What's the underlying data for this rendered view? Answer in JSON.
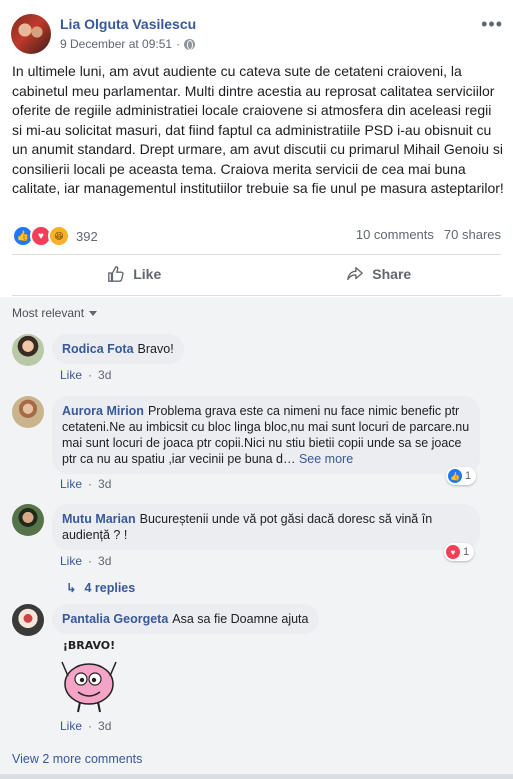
{
  "post": {
    "author": "Lia Olguta Vasilescu",
    "timestamp": "9 December at 09:51",
    "separator": "·",
    "text": "In ultimele luni, am avut audiente cu cateva sute de cetateni craioveni, la cabinetul meu parlamentar. Multi dintre acestia au reprosat calitatea serviciilor oferite de regiile administratiei locale craiovene si atmosfera din aceleasi regii si mi-au solicitat masuri, dat fiind faptul ca administratiile PSD i-au obisnuit cu un anumit standard. Drept urmare, am avut discutii cu primarul Mihail Genoiu si consilierii locali pe aceasta tema. Craiova merita servicii de cea mai buna calitate, iar managementul institutiilor trebuie sa fie unul pe masura asteptarilor!",
    "reaction_count": "392",
    "comments_count": "10 comments",
    "shares_count": "70 shares"
  },
  "actions": {
    "like": "Like",
    "share": "Share"
  },
  "sort_label": "Most relevant",
  "comments": [
    {
      "name": "Rodica Fota",
      "text": "Bravo!",
      "like": "Like",
      "sep": "·",
      "time": "3d"
    },
    {
      "name": "Aurora Mirion",
      "text": "Problema grava este ca nimeni nu face nimic benefic ptr cetateni.Ne au imbicsit cu bloc linga bloc,nu mai sunt locuri de parcare.nu mai sunt locuri de joaca ptr copii.Nici nu stiu bietii copii unde sa se joace ptr ca nu au spatiu ,iar vecinii pe buna d…",
      "see_more": "See more",
      "like": "Like",
      "sep": "·",
      "time": "3d",
      "reaction_count": "1"
    },
    {
      "name": "Mutu Marian",
      "text": "Bucureștenii unde vă pot găsi dacă doresc să vină în audiență ? !",
      "like": "Like",
      "sep": "·",
      "time": "3d",
      "reaction_count": "1"
    },
    {
      "name": "Pantalia Georgeta",
      "text": "Asa sa fie Doamne ajuta",
      "like": "Like",
      "sep": "·",
      "time": "3d",
      "sticker_text": "¡BRAVO!"
    }
  ],
  "replies_label": "4 replies",
  "view_more": "View 2 more comments",
  "colors": {
    "link": "#385898",
    "like_blue": "#2078f4",
    "love_red": "#f33e58",
    "haha_yellow": "#f7b125"
  }
}
